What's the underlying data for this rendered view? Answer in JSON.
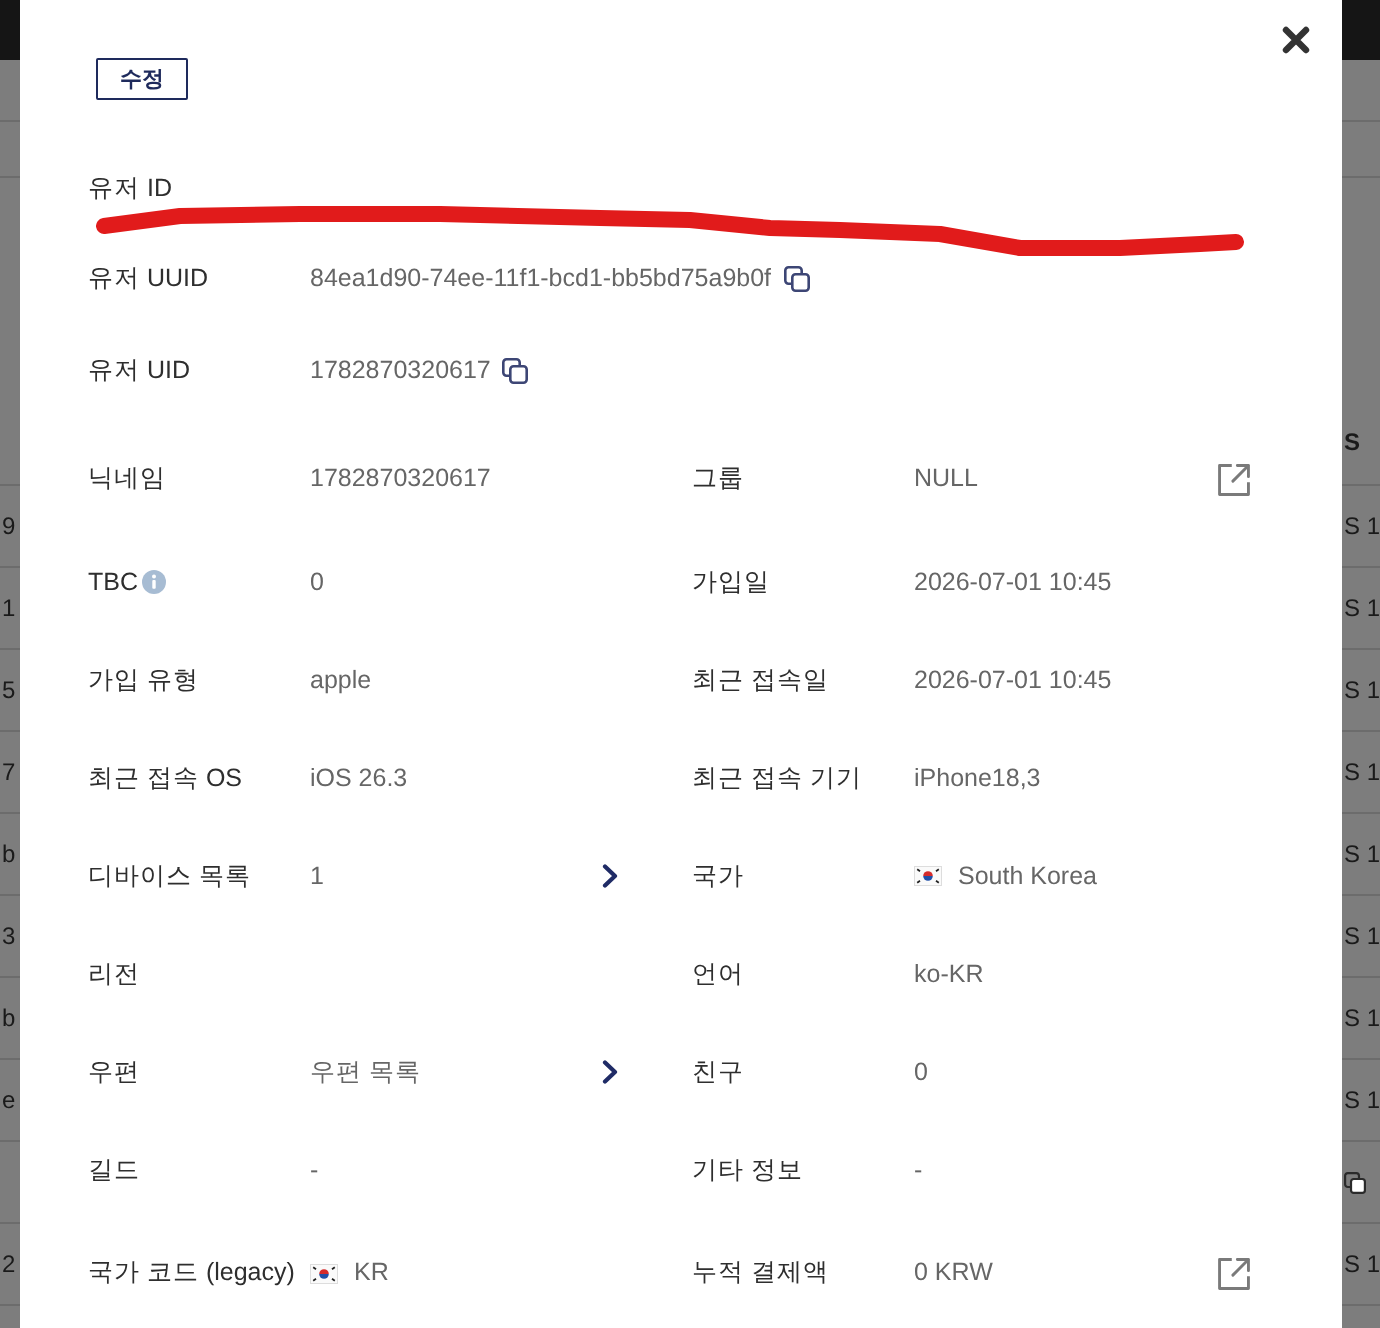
{
  "backdrop": {
    "header": {
      "column_2": "S"
    },
    "rows": [
      {
        "kind": "text",
        "column_1": "9",
        "column_2": "S 1"
      },
      {
        "kind": "text",
        "column_1": "1",
        "column_2": "S 1"
      },
      {
        "kind": "text",
        "column_1": "5",
        "column_2": "S 1"
      },
      {
        "kind": "text",
        "column_1": "7",
        "column_2": "S 1"
      },
      {
        "kind": "text",
        "column_1": "b",
        "column_2": "S 1"
      },
      {
        "kind": "text",
        "column_1": "3",
        "column_2": "S 1"
      },
      {
        "kind": "text",
        "column_1": "b",
        "column_2": "S 1"
      },
      {
        "kind": "text",
        "column_1": "e",
        "column_2": "S 1"
      },
      {
        "kind": "icon"
      },
      {
        "kind": "text",
        "column_1": "2",
        "column_2": "S 1"
      }
    ]
  },
  "dialog": {
    "edit_button": "수정",
    "fields": [
      {
        "label": "유저 ID",
        "redacted": true
      },
      {
        "label": "유저 UUID",
        "value": "84ea1d90-74ee-11f1-bcd1-bb5bd75a9b0f",
        "copyable": true
      },
      {
        "label": "유저 UID",
        "value": "1782870320617",
        "copyable": true
      }
    ],
    "details": [
      {
        "kind": "plain",
        "label": "닉네임",
        "value": "1782870320617"
      },
      {
        "kind": "link",
        "label": "그룹",
        "value": "NULL"
      },
      {
        "kind": "plain",
        "label": "TBC",
        "info": true,
        "value": "0"
      },
      {
        "kind": "plain",
        "label": "가입일",
        "value": "2026-07-01 10:45"
      },
      {
        "kind": "plain",
        "label": "가입 유형",
        "value": "apple"
      },
      {
        "kind": "plain",
        "label": "최근 접속일",
        "value": "2026-07-01 10:45"
      },
      {
        "kind": "plain",
        "label": "최근 접속 OS",
        "value": "iOS 26.3"
      },
      {
        "kind": "plain",
        "label": "최근 접속 기기",
        "value": "iPhone18,3"
      },
      {
        "kind": "chevron",
        "label": "디바이스 목록",
        "value": "1"
      },
      {
        "kind": "plain",
        "label": "국가",
        "value": "South Korea",
        "flag": true
      },
      {
        "kind": "plain",
        "label": "리전"
      },
      {
        "kind": "plain",
        "label": "언어",
        "value": "ko-KR"
      },
      {
        "kind": "chevron",
        "label": "우편",
        "value": "우편 목록"
      },
      {
        "kind": "plain",
        "label": "친구",
        "value": "0"
      },
      {
        "kind": "plain",
        "label": "길드",
        "value": "-"
      },
      {
        "kind": "plain",
        "label": "기타 정보",
        "value": "-"
      },
      {
        "kind": "plain",
        "label": "국가 코드 (legacy)",
        "value": "KR",
        "flag": true
      },
      {
        "kind": "link",
        "label": "누적 결제액",
        "value": "0 KRW"
      }
    ]
  }
}
